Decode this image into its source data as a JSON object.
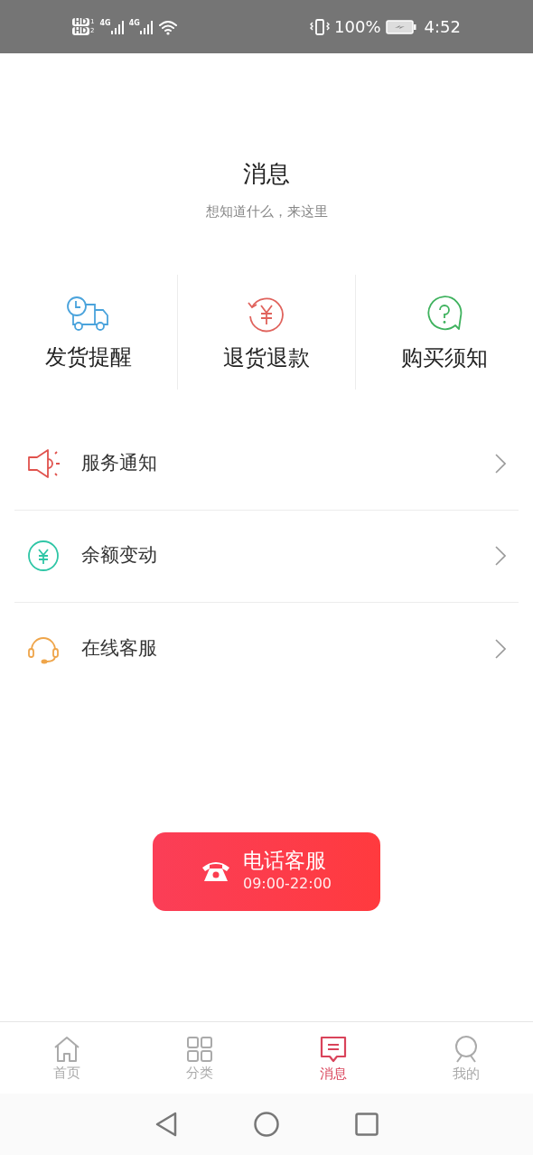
{
  "status_bar": {
    "sim_badges": [
      {
        "label": "HD",
        "slot": "1"
      },
      {
        "label": "HD",
        "slot": "2"
      }
    ],
    "networks": [
      "4G",
      "4G"
    ],
    "battery": "100%",
    "time": "4:52"
  },
  "header": {
    "title": "消息",
    "subtitle": "想知道什么，来这里"
  },
  "shortcuts": [
    {
      "kind": "truck",
      "label": "发货提醒"
    },
    {
      "kind": "refund",
      "label": "退货退款"
    },
    {
      "kind": "question",
      "label": "购买须知"
    }
  ],
  "menu": [
    {
      "kind": "speaker",
      "label": "服务通知"
    },
    {
      "kind": "yen",
      "label": "余额变动"
    },
    {
      "kind": "headset",
      "label": "在线客服"
    }
  ],
  "hotline": {
    "title": "电话客服",
    "hours": "09:00-22:00"
  },
  "tabs": [
    {
      "kind": "home",
      "label": "首页",
      "selected": false
    },
    {
      "kind": "grid",
      "label": "分类",
      "selected": false
    },
    {
      "kind": "message",
      "label": "消息",
      "selected": true
    },
    {
      "kind": "person",
      "label": "我的",
      "selected": false
    }
  ]
}
